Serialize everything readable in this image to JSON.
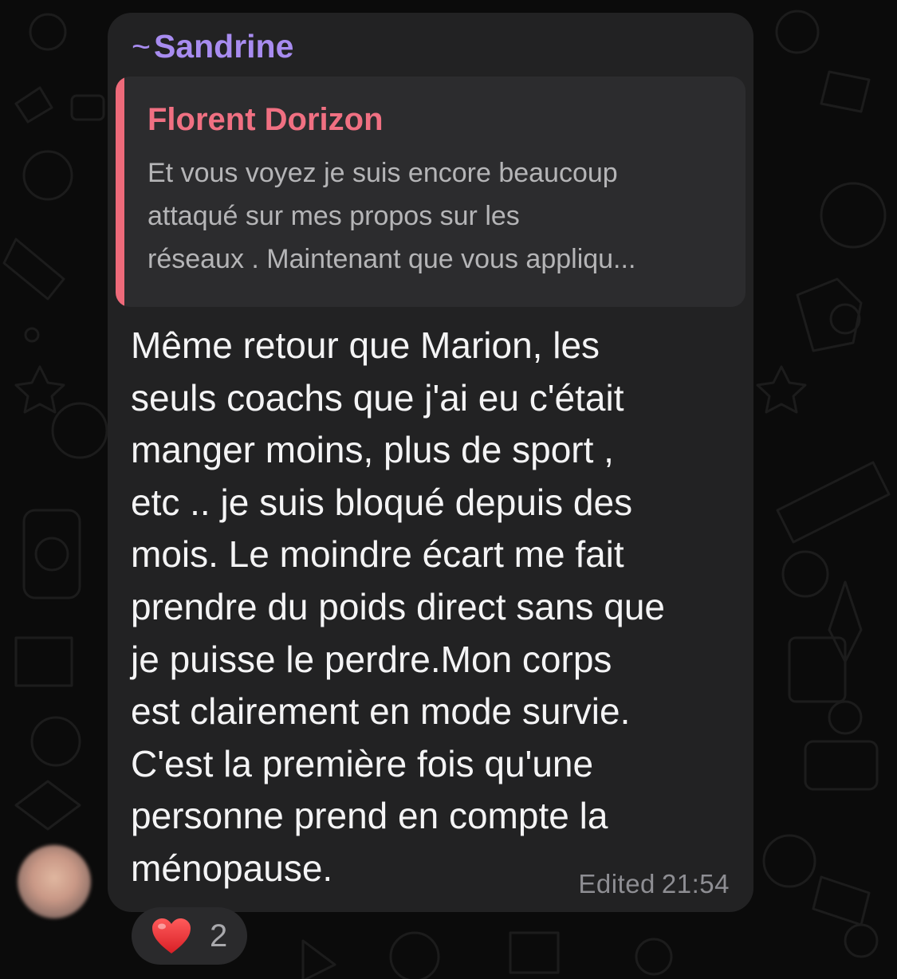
{
  "message": {
    "sender_prefix": "~",
    "sender": "Sandrine",
    "reply": {
      "author": "Florent Dorizon",
      "lines": [
        "Et vous voyez je suis encore beaucoup",
        "attaqué sur mes propos sur les",
        "réseaux . Maintenant que vous appliqu..."
      ]
    },
    "body_lines": [
      "Même retour que Marion, les",
      "seuls coachs que j'ai eu c'était",
      "manger moins, plus de sport ,",
      "etc .. je suis bloqué depuis des",
      "mois. Le moindre écart me fait",
      "prendre du poids direct sans que",
      "je puisse le perdre.Mon corps",
      "est clairement en mode survie.",
      "C'est la première fois qu'une",
      "personne prend en compte la",
      "ménopause."
    ],
    "edited_label": "Edited",
    "time": "21:54"
  },
  "reaction": {
    "icon": "heart-icon",
    "count": "2"
  },
  "colors": {
    "sender": "#a88cf0",
    "reply_accent": "#ee6a7a",
    "bubble": "#222223",
    "background": "#0b0b0b"
  }
}
